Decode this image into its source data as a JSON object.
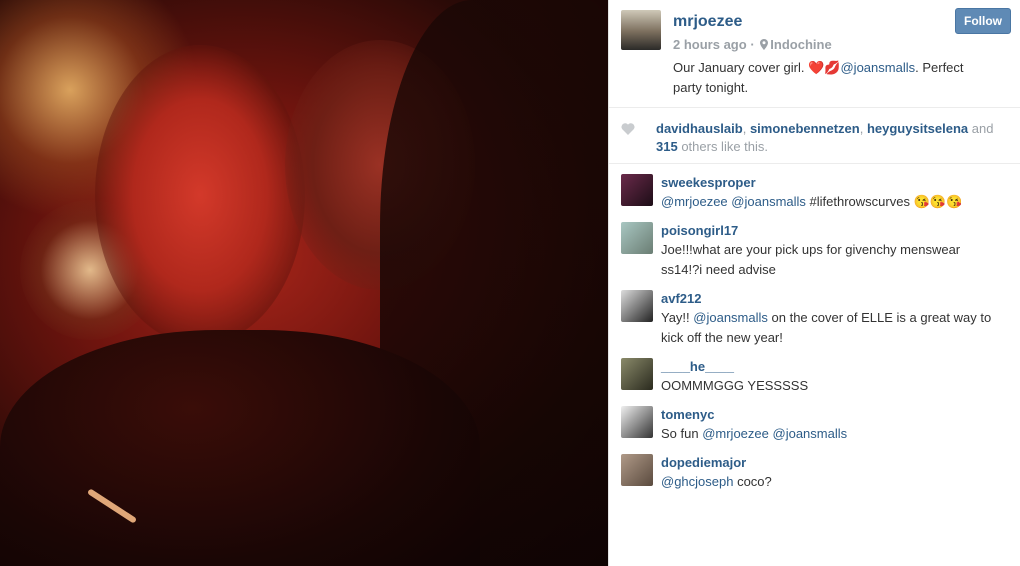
{
  "post": {
    "username": "mrjoezee",
    "time": "2 hours ago",
    "separator": "·",
    "location": "Indochine",
    "follow_label": "Follow",
    "caption_prefix": "Our January cover girl. ",
    "caption_mention": "@joansmalls",
    "caption_suffix": ". Perfect party tonight."
  },
  "likes": {
    "user1": "davidhauslaib",
    "sep1": ", ",
    "user2": "simonebennetzen",
    "sep2": ", ",
    "user3": "heyguysitselena",
    "and_text": " and",
    "count": "315",
    "others_text": " others like this."
  },
  "comments": [
    {
      "user": "sweekesproper",
      "parts": [
        {
          "t": "@mrjoezee",
          "m": true
        },
        {
          "t": " ",
          "m": false
        },
        {
          "t": "@joansmalls",
          "m": true
        },
        {
          "t": " #lifethrowscurves 😘😘😘",
          "m": false
        }
      ]
    },
    {
      "user": "poisongirl17",
      "parts": [
        {
          "t": "Joe!!!what are your pick ups for givenchy menswear ss14!?i need advise",
          "m": false
        }
      ]
    },
    {
      "user": "avf212",
      "parts": [
        {
          "t": "Yay!! ",
          "m": false
        },
        {
          "t": "@joansmalls",
          "m": true
        },
        {
          "t": " on the cover of ELLE is a great way to kick off the new year!",
          "m": false
        }
      ]
    },
    {
      "user": "____he____",
      "parts": [
        {
          "t": "OOMMMGGG YESSSSS",
          "m": false
        }
      ]
    },
    {
      "user": "tomenyc",
      "parts": [
        {
          "t": "So fun ",
          "m": false
        },
        {
          "t": "@mrjoezee",
          "m": true
        },
        {
          "t": " ",
          "m": false
        },
        {
          "t": "@joansmalls",
          "m": true
        }
      ]
    },
    {
      "user": "dopediemajor",
      "parts": [
        {
          "t": "@ghcjoseph",
          "m": true
        },
        {
          "t": " coco?",
          "m": false
        }
      ]
    }
  ],
  "colors": {
    "link": "#2d5c88",
    "follow_bg": "#5f8ab5",
    "muted": "#9aa0a6"
  }
}
